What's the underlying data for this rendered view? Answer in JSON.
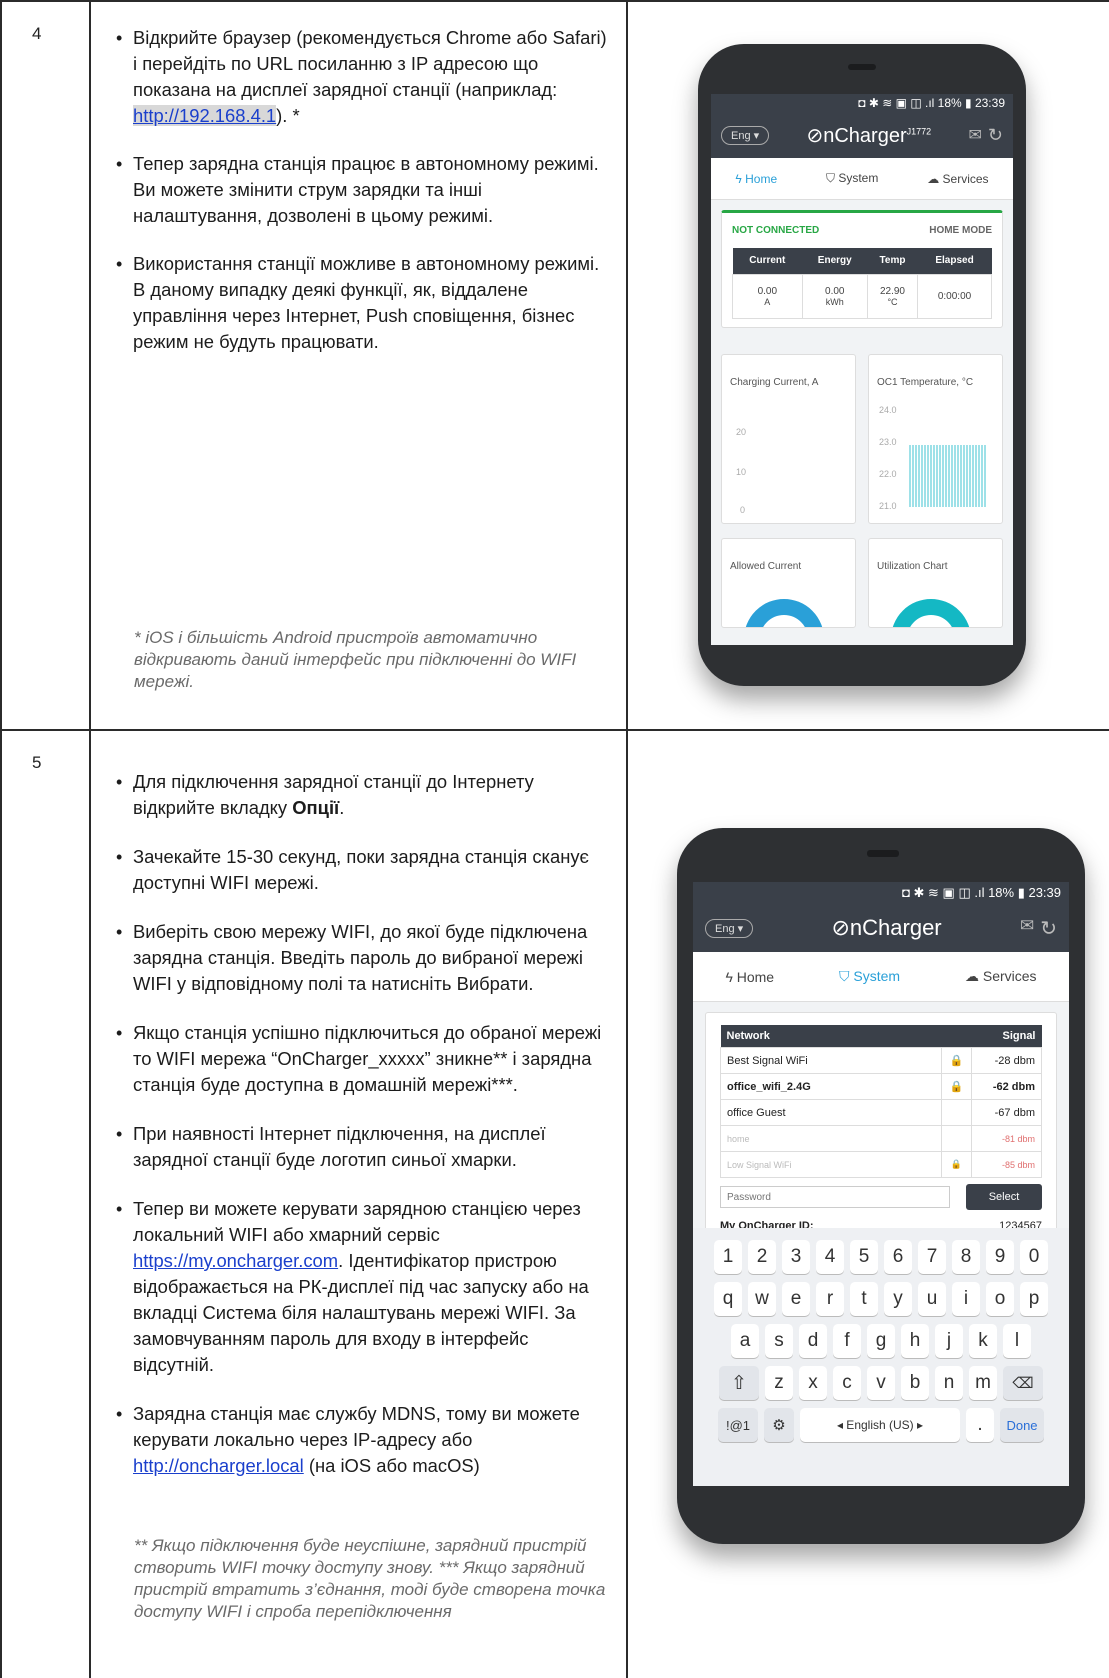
{
  "rows": [
    {
      "number": "4",
      "bullets": [
        [
          "Відкрийте браузер (рекомендується Chrome або Safari) і перейдіть по URL посиланню з IP адресою що показана на дисплеї зарядної станції (наприклад: ",
          "http://192.168.4.1",
          "). *"
        ],
        "Тепер зарядна станція працює в автономному режимі. Ви можете змінити струм зарядки та інші налаштування, дозволені в цьому режимі.",
        "Використання станції можливе в автономному режимі. В даному випадку деякі функції, як, віддалене управління через Інтернет, Push сповіщення, бізнес режим не будуть працювати."
      ],
      "note": "* iOS і більшість Android пристроїв автоматично відкривають даний інтерфейс при підключенні до WIFI мережі."
    },
    {
      "number": "5",
      "bullets": [
        [
          "Для підключення зарядної станції до Інтернету відкрийте вкладку ",
          "Опції",
          "."
        ],
        "Зачекайте 15-30 секунд, поки зарядна станція сканує доступні WIFI мережі.",
        "Виберіть свою мережу WIFI, до якої буде підключена зарядна станція. Введіть пароль до вибраної мережі WIFI у відповідному полі та натисніть Вибрати.",
        "Якщо станція успішно підключиться до обраної мережі то WIFI мережа “OnCharger_xxxxx” зникне** і зарядна станція буде доступна в домашній мережі***.",
        "При наявності Інтернет підключення, на дисплеї зарядної станції буде логотип синьої хмарки.",
        [
          "Тепер ви можете керувати зарядною станцією через локальний WIFI або хмарний сервіс ",
          "https://my.oncharger.com",
          ". Ідентифікатор пристрою відображається на РК-дисплеї під час запуску або на вкладці Система біля налаштувань мережі WIFI. За замовчуванням пароль для входу в інтерфейс відсутній."
        ],
        [
          "Зарядна станція має службу MDNS, тому ви можете керувати локально через IP-адресу або ",
          "http://oncharger.local",
          " (на iOS або macOS)"
        ]
      ],
      "note": "** Якщо підключення буде неуспішне, зарядний пристрій створить WIFI точку доступу знову. *** Якщо зарядний пристрій втратить з’єднання, тоді буде створена точка доступу WIFI і спроба перепідключення"
    }
  ],
  "phone1": {
    "status": "◘ ✱ ≋ ▣ ◫ .ıl 18% ▮ 23:39",
    "lang": "Eng ▾",
    "logo": "⊘nCharger",
    "sup": "J1772",
    "tabs": [
      "Home",
      "System",
      "Services"
    ],
    "conn": "NOT CONNECTED",
    "mode": "HOME MODE",
    "stat_heads": [
      "Current",
      "Energy",
      "Temp",
      "Elapsed"
    ],
    "stat_vals": [
      "0.00",
      "0.00",
      "22.90",
      "0:00:00"
    ],
    "stat_units": [
      "A",
      "kWh",
      "°C",
      ""
    ],
    "c1_title": "Charging Current, A",
    "c1_ticks": [
      "20",
      "10",
      "0"
    ],
    "c2_title": "OC1 Temperature, °C",
    "c2_ticks": [
      "24.0",
      "23.0",
      "22.0",
      "21.0"
    ],
    "c3_title": "Allowed Current",
    "c4_title": "Utilization Chart"
  },
  "phone2": {
    "status": "◘ ✱ ≋ ▣ ◫ .ıl 18% ▮ 23:39",
    "lang": "Eng ▾",
    "logo": "⊘nCharger",
    "tabs": [
      "Home",
      "System",
      "Services"
    ],
    "net_head": [
      "Network",
      "Signal"
    ],
    "networks": [
      {
        "name": "Best Signal WiFi",
        "lock": "🔒",
        "signal": "-28 dbm",
        "style": "normal"
      },
      {
        "name": "office_wifi_2.4G",
        "lock": "🔒",
        "signal": "-62 dbm",
        "style": "bold"
      },
      {
        "name": "office Guest",
        "lock": "",
        "signal": "-67 dbm",
        "style": "normal"
      },
      {
        "name": "home",
        "lock": "",
        "signal": "-81 dbm",
        "style": "weak"
      },
      {
        "name": "Low Signal WiFi",
        "lock": "🔒",
        "signal": "-85 dbm",
        "style": "weak"
      }
    ],
    "password_placeholder": "Password",
    "select_label": "Select",
    "id_label": "My OnCharger ID:",
    "id_value": "1234567",
    "kb_row1": [
      "1",
      "2",
      "3",
      "4",
      "5",
      "6",
      "7",
      "8",
      "9",
      "0"
    ],
    "kb_row2": [
      "q",
      "w",
      "e",
      "r",
      "t",
      "y",
      "u",
      "i",
      "o",
      "p"
    ],
    "kb_row3": [
      "a",
      "s",
      "d",
      "f",
      "g",
      "h",
      "j",
      "k",
      "l"
    ],
    "kb_row4": [
      "z",
      "x",
      "c",
      "v",
      "b",
      "n",
      "m"
    ],
    "kb_sym": "!@1",
    "kb_space": "◂ English (US) ▸",
    "kb_dot": ".",
    "kb_done": "Done"
  },
  "colors": {
    "accent": "#2aa0d8",
    "green": "#28a745",
    "dark": "#3a4049",
    "link": "#1a3fcc"
  }
}
